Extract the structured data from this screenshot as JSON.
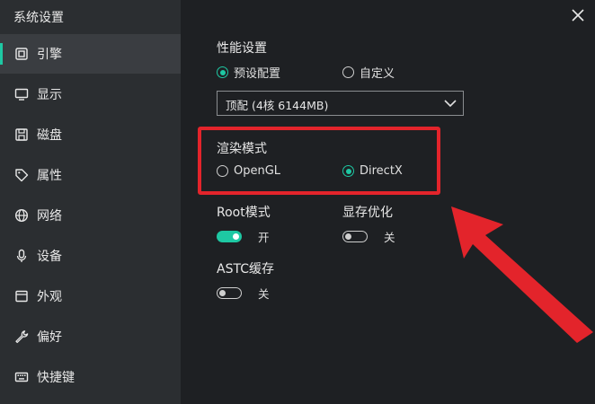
{
  "window": {
    "title": "系统设置"
  },
  "sidebar": {
    "items": [
      {
        "label": "引擎",
        "icon": "chip-icon",
        "active": true
      },
      {
        "label": "显示",
        "icon": "monitor-icon"
      },
      {
        "label": "磁盘",
        "icon": "disk-icon"
      },
      {
        "label": "属性",
        "icon": "tag-icon"
      },
      {
        "label": "网络",
        "icon": "globe-icon"
      },
      {
        "label": "设备",
        "icon": "microphone-icon"
      },
      {
        "label": "外观",
        "icon": "window-icon"
      },
      {
        "label": "偏好",
        "icon": "wrench-icon"
      },
      {
        "label": "快捷键",
        "icon": "keyboard-icon"
      }
    ]
  },
  "performance": {
    "title": "性能设置",
    "options": [
      {
        "label": "预设配置",
        "selected": true
      },
      {
        "label": "自定义",
        "selected": false
      }
    ],
    "dropdown_value": "顶配 (4核 6144MB)"
  },
  "render_mode": {
    "title": "渲染模式",
    "options": [
      {
        "label": "OpenGL",
        "selected": false
      },
      {
        "label": "DirectX",
        "selected": true
      }
    ]
  },
  "toggles": {
    "root": {
      "title": "Root模式",
      "state_text": "开",
      "on": true
    },
    "vram": {
      "title": "显存优化",
      "state_text": "关",
      "on": false
    },
    "astc": {
      "title": "ASTC缓存",
      "state_text": "关",
      "on": false
    }
  },
  "colors": {
    "accent": "#1ec8a3",
    "annotation": "#e3242b"
  }
}
